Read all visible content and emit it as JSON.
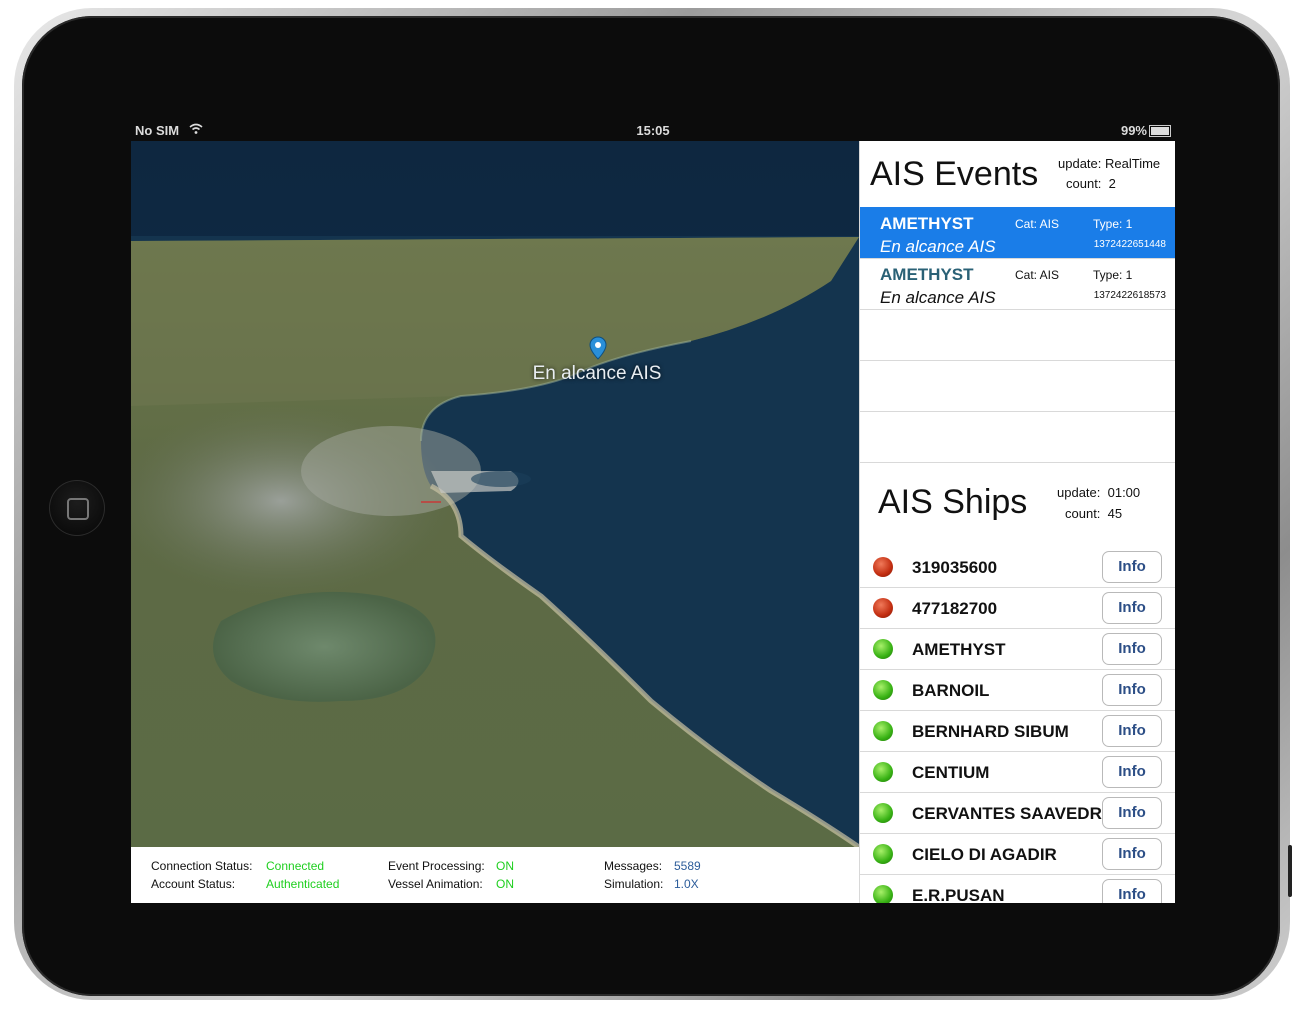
{
  "statusbar": {
    "carrier": "No SIM",
    "time": "15:05",
    "battery": "99%"
  },
  "map": {
    "annotation": "En alcance AIS"
  },
  "status": {
    "connection_label": "Connection Status:",
    "connection_value": "Connected",
    "account_label": "Account Status:",
    "account_value": "Authenticated",
    "event_label": "Event Processing:",
    "event_value": "ON",
    "vessel_label": "Vessel Animation:",
    "vessel_value": "ON",
    "messages_label": "Messages:",
    "messages_value": "5589",
    "simulation_label": "Simulation:",
    "simulation_value": "1.0X"
  },
  "events": {
    "title": "AIS Events",
    "update_label": "update:",
    "update_value": "RealTime",
    "count_label": "count:",
    "count_value": "2",
    "items": [
      {
        "name": "AMETHYST",
        "sub": "En alcance AIS",
        "cat": "Cat:  AIS",
        "type": "Type:  1",
        "ts": "1372422651448",
        "selected": true
      },
      {
        "name": "AMETHYST",
        "sub": "En alcance AIS",
        "cat": "Cat:  AIS",
        "type": "Type:  1",
        "ts": "1372422618573",
        "selected": false
      }
    ]
  },
  "ships": {
    "title": "AIS Ships",
    "update_label": "update:",
    "update_value": "01:00",
    "count_label": "count:",
    "count_value": "45",
    "info_label": "Info",
    "items": [
      {
        "name": "319035600",
        "status": "red"
      },
      {
        "name": "477182700",
        "status": "red"
      },
      {
        "name": "AMETHYST",
        "status": "green"
      },
      {
        "name": "BARNOIL",
        "status": "green"
      },
      {
        "name": "BERNHARD SIBUM",
        "status": "green"
      },
      {
        "name": "CENTIUM",
        "status": "green"
      },
      {
        "name": "CERVANTES SAAVEDRA",
        "status": "green"
      },
      {
        "name": "CIELO DI AGADIR",
        "status": "green"
      },
      {
        "name": "E.R.PUSAN",
        "status": "green"
      }
    ]
  },
  "colors": {
    "selected_row": "#1a7de8",
    "status_ok": "#1fcf1f",
    "ship_active": "#38b214",
    "ship_alert": "#c22d10"
  }
}
